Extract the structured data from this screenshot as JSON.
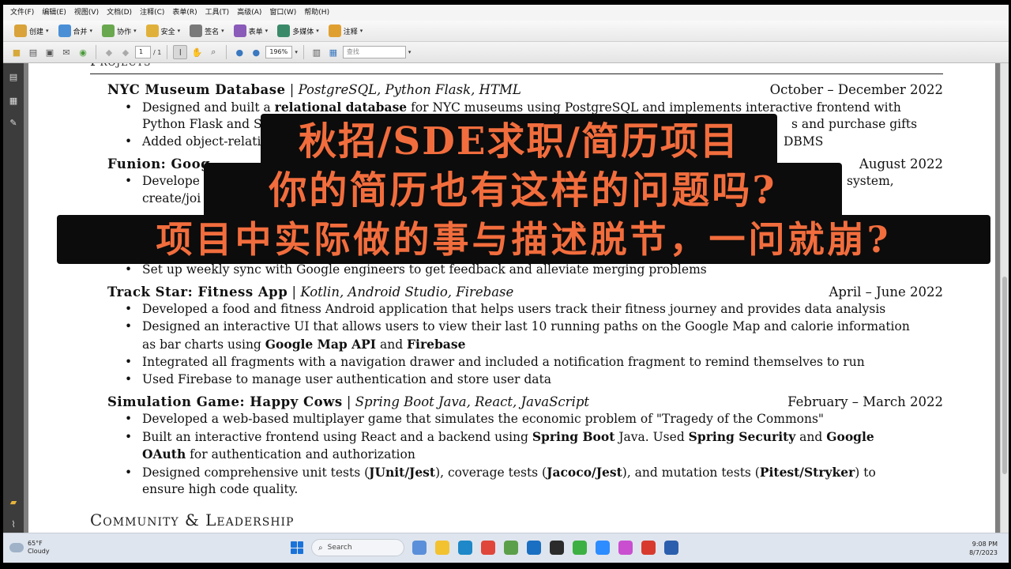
{
  "menu": [
    "文件(F)",
    "编辑(E)",
    "视图(V)",
    "文档(D)",
    "注释(C)",
    "表单(R)",
    "工具(T)",
    "高级(A)",
    "窗口(W)",
    "帮助(H)"
  ],
  "toolbar1": [
    {
      "label": "创建",
      "icon": "create-icon",
      "color": "#d9a23a"
    },
    {
      "label": "合并",
      "icon": "combine-icon",
      "color": "#4a8fd6"
    },
    {
      "label": "协作",
      "icon": "collaborate-icon",
      "color": "#6aa84f"
    },
    {
      "label": "安全",
      "icon": "lock-icon",
      "color": "#e0b13a"
    },
    {
      "label": "签名",
      "icon": "pen-icon",
      "color": "#7a7a7a"
    },
    {
      "label": "表单",
      "icon": "form-icon",
      "color": "#8a5bb8"
    },
    {
      "label": "多媒体",
      "icon": "multimedia-icon",
      "color": "#3a8a6a"
    },
    {
      "label": "注释",
      "icon": "comment-icon",
      "color": "#e0a030"
    }
  ],
  "toolbar2": {
    "page_current": "1",
    "page_total": "/ 1",
    "zoom": "196%",
    "search_placeholder": "查找"
  },
  "resume": {
    "section_projects": "Projects",
    "p1": {
      "name": "NYC Museum Database",
      "sep": " | ",
      "tech": "PostgreSQL, Python Flask, HTML",
      "date": "October – December 2022",
      "b1_pre": "Designed and built a ",
      "b1_bold": "relational database",
      "b1_post": " for NYC museums using PostgreSQL and implements interactive frontend with",
      "b1_cont_left": "Python Flask and S",
      "b1_cont_right": "s and purchase gifts",
      "b2_left": "Added object-relati",
      "b2_right": "DBMS"
    },
    "p2": {
      "name_partial": "Funion: Goog",
      "date_partial": "August 2022",
      "b1_left": "Develope",
      "b1_right": "system,",
      "b1_cont": "create/joi",
      "b4": "Set up weekly sync with Google engineers to get feedback and alleviate merging problems"
    },
    "p3": {
      "name": "Track Star: Fitness App",
      "sep": " | ",
      "tech": "Kotlin, Android Studio, Firebase",
      "date": "April – June 2022",
      "b1": "Developed a food and fitness Android application that helps users track their fitness journey and provides data analysis",
      "b2": "Designed an interactive UI that allows users to view their last 10 running paths on the Google Map and calorie information",
      "b2_cont_pre": "as bar charts using ",
      "b2_cont_bold1": "Google Map API",
      "b2_cont_mid": " and ",
      "b2_cont_bold2": "Firebase",
      "b3": "Integrated all fragments with a navigation drawer and included a notification fragment to remind themselves to run",
      "b4": "Used Firebase to manage user authentication and store user data"
    },
    "p4": {
      "name": "Simulation Game: Happy Cows",
      "sep": " | ",
      "tech": "Spring Boot Java, React, JavaScript",
      "date": "February – March 2022",
      "b1": "Developed a web-based multiplayer game that simulates the economic problem of \"Tragedy of the Commons\"",
      "b2_pre": "Built an interactive frontend using React and a backend using ",
      "b2_bold1": "Spring Boot",
      "b2_mid1": " Java. Used ",
      "b2_bold2": "Spring Security",
      "b2_mid2": " and ",
      "b2_bold3": "Google",
      "b2_cont_bold": "OAuth",
      "b2_cont_post": " for authentication and authorization",
      "b3_pre": "Designed comprehensive unit tests (",
      "b3_bold1": "JUnit/Jest",
      "b3_mid1": "), coverage tests (",
      "b3_bold2": "Jacoco/Jest",
      "b3_mid2": "), and mutation tests (",
      "b3_bold3": "Pitest/Stryker",
      "b3_post": ") to",
      "b3_cont": "ensure high code quality."
    },
    "section_community": "Community & Leadership"
  },
  "overlay": {
    "line1": "秋招/SDE求职/简历项目",
    "line2": "你的简历也有这样的问题吗?",
    "line3": "项目中实际做的事与描述脱节，一问就崩?",
    "color": "#f26d3d"
  },
  "taskbar": {
    "temp": "65°F",
    "condition": "Cloudy",
    "search_label": "Search",
    "time": "9:08 PM",
    "date": "8/7/2023",
    "apps": [
      {
        "icon": "copilot-icon",
        "color": "#5b8fd9"
      },
      {
        "icon": "files-icon",
        "color": "#f2c230"
      },
      {
        "icon": "edge-icon",
        "color": "#1e88c8"
      },
      {
        "icon": "chrome-icon",
        "color": "#e0463a"
      },
      {
        "icon": "tool-icon",
        "color": "#5c9f4a"
      },
      {
        "icon": "outlook-icon",
        "color": "#1a6fc2"
      },
      {
        "icon": "terminal-icon",
        "color": "#2b2b2b"
      },
      {
        "icon": "wechat-icon",
        "color": "#3cb043"
      },
      {
        "icon": "zoom-icon",
        "color": "#2d8cff"
      },
      {
        "icon": "colorful-app-icon",
        "color": "#c94fd0"
      },
      {
        "icon": "acrobat-icon",
        "color": "#d83b2e"
      },
      {
        "icon": "word-icon",
        "color": "#2b5fad"
      }
    ]
  }
}
